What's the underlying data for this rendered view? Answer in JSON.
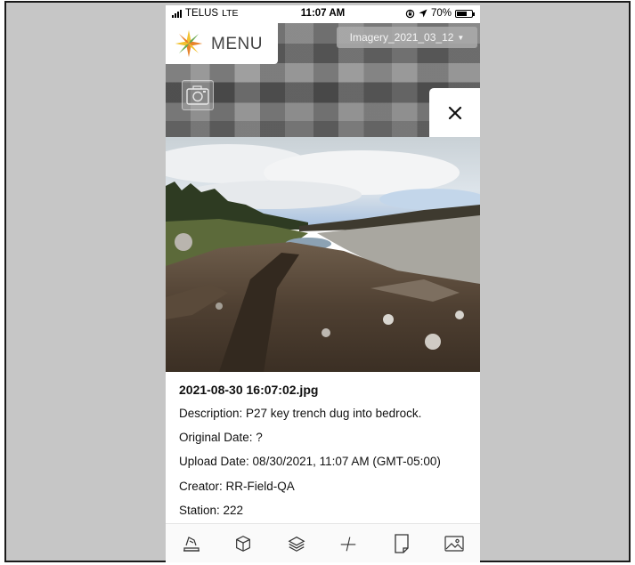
{
  "status_bar": {
    "carrier": "TELUS",
    "network": "LTE",
    "time": "11:07 AM",
    "battery_percent": "70%",
    "battery_level": 0.7,
    "icons": [
      "signal-icon",
      "location-arrow-icon",
      "rotation-lock-icon",
      "battery-icon"
    ]
  },
  "header": {
    "menu_label": "MENU",
    "logo_icon": "compass-star-logo",
    "imagery_selected": "Imagery_2021_03_12"
  },
  "map_controls": {
    "camera_icon": "camera-icon",
    "close_icon": "close-icon"
  },
  "photo": {
    "icon": "site-photo"
  },
  "details": {
    "filename": "2021-08-30 16:07:02.jpg",
    "description": "Description: P27 key trench dug into bedrock.",
    "original_date": "Original Date: ?",
    "upload_date": "Upload Date: 08/30/2021, 11:07 AM (GMT-05:00)",
    "creator": "Creator: RR-Field-QA",
    "station": "Station: 222"
  },
  "toolbar": {
    "items": [
      {
        "name": "map-draw-icon"
      },
      {
        "name": "3d-box-icon"
      },
      {
        "name": "layers-icon"
      },
      {
        "name": "measure-icon"
      },
      {
        "name": "document-icon"
      },
      {
        "name": "image-gallery-icon"
      }
    ]
  },
  "colors": {
    "frame_background": "#c6c6c6",
    "logo_orange": "#e8832a",
    "logo_yellow": "#f2c12e",
    "logo_green": "#6aa84f"
  }
}
